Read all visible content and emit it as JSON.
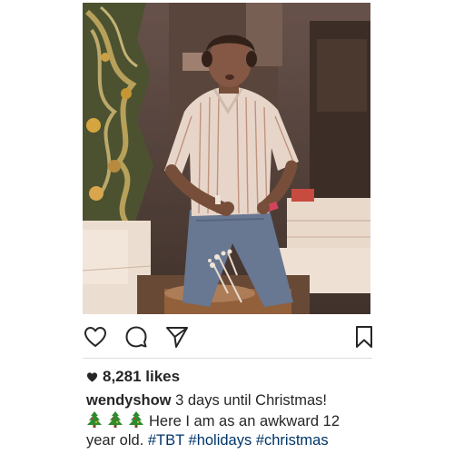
{
  "post": {
    "likes_count": "8,281 likes",
    "caption": {
      "username": "wendyshow",
      "line1_text": " 3 days until Christmas!",
      "line2_text": "Here I am as an awkward 12",
      "line3_text": "year old. ",
      "hashtags": [
        "#TBT",
        "#holidays",
        "#christmas"
      ],
      "emoji": [
        "christmas-tree",
        "christmas-tree",
        "christmas-tree"
      ]
    },
    "actions": {
      "like_icon": "heart-outline-icon",
      "comment_icon": "comment-bubble-icon",
      "share_icon": "paper-plane-icon",
      "save_icon": "bookmark-icon"
    }
  },
  "colors": {
    "text": "#262626",
    "hashtag": "#003569",
    "divider": "#dbdbdb",
    "tree_green": "#2e8b2e"
  }
}
